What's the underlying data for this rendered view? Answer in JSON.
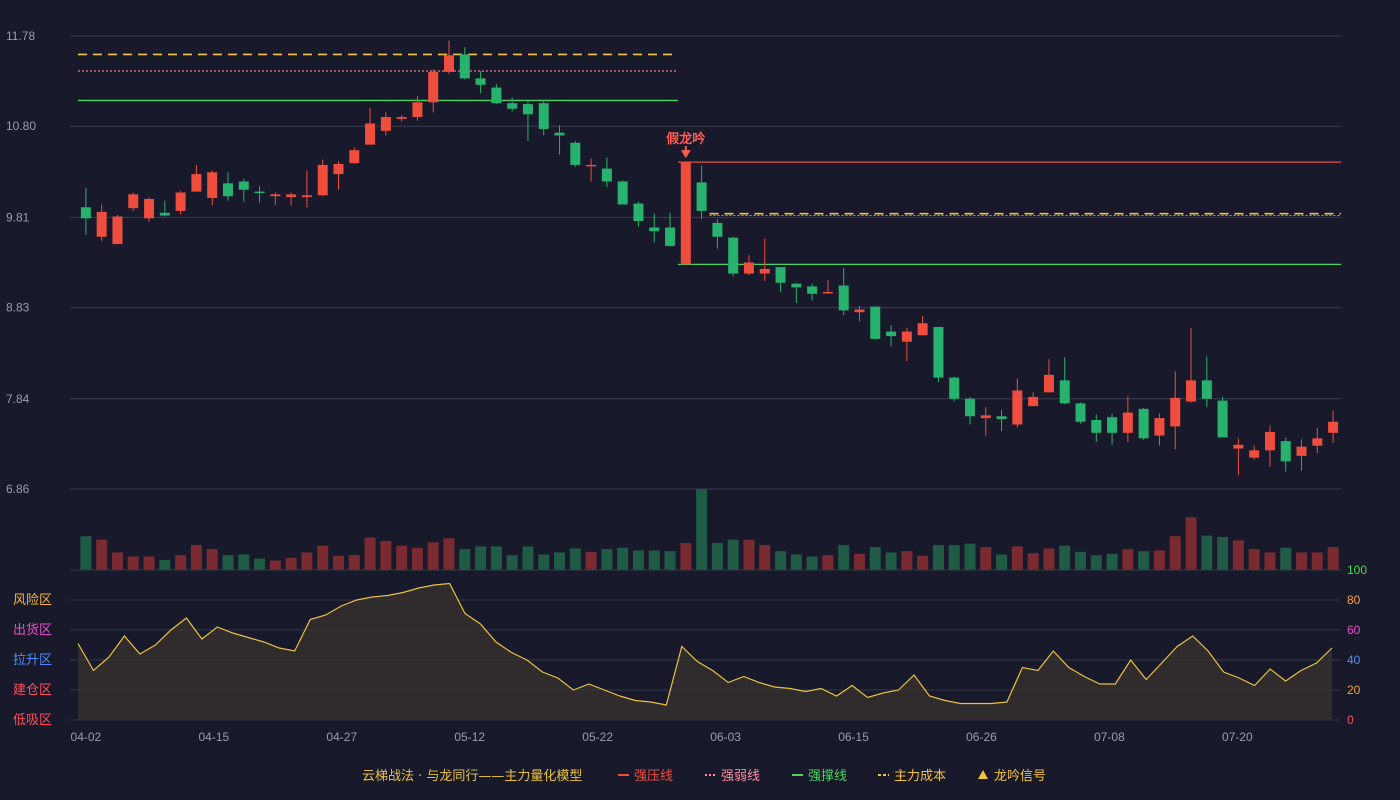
{
  "chart_data": {
    "type": "candlestick",
    "price_axis": {
      "ylim": [
        6.86,
        11.78
      ],
      "ticks": [
        "11.78",
        "10.80",
        "9.81",
        "8.83",
        "7.84",
        "6.86"
      ]
    },
    "x_tick_labels": [
      {
        "index": 0,
        "label": "04-02"
      },
      {
        "index": 8,
        "label": "04-15"
      },
      {
        "index": 16,
        "label": "04-27"
      },
      {
        "index": 24,
        "label": "05-12"
      },
      {
        "index": 32,
        "label": "05-22"
      },
      {
        "index": 40,
        "label": "06-03"
      },
      {
        "index": 48,
        "label": "06-15"
      },
      {
        "index": 56,
        "label": "06-26"
      },
      {
        "index": 64,
        "label": "07-08"
      },
      {
        "index": 72,
        "label": "07-20"
      }
    ],
    "candles": [
      [
        9.92,
        9.8,
        10.13,
        9.62
      ],
      [
        9.6,
        9.87,
        9.95,
        9.55
      ],
      [
        9.52,
        9.82,
        9.84,
        9.52
      ],
      [
        9.91,
        10.06,
        10.08,
        9.88
      ],
      [
        9.8,
        10.01,
        10.03,
        9.76
      ],
      [
        9.86,
        9.83,
        9.99,
        9.82
      ],
      [
        9.88,
        10.08,
        10.1,
        9.84
      ],
      [
        10.09,
        10.28,
        10.38,
        10.09
      ],
      [
        10.02,
        10.3,
        10.32,
        9.94
      ],
      [
        10.18,
        10.04,
        10.3,
        9.99
      ],
      [
        10.2,
        10.11,
        10.23,
        9.98
      ],
      [
        10.09,
        10.08,
        10.15,
        9.97
      ],
      [
        10.04,
        10.06,
        10.08,
        9.95
      ],
      [
        10.03,
        10.06,
        10.08,
        9.94
      ],
      [
        10.03,
        10.05,
        10.32,
        9.92
      ],
      [
        10.05,
        10.38,
        10.44,
        10.04
      ],
      [
        10.28,
        10.39,
        10.42,
        10.11
      ],
      [
        10.4,
        10.54,
        10.57,
        10.39
      ],
      [
        10.6,
        10.83,
        11.0,
        10.62
      ],
      [
        10.75,
        10.9,
        10.95,
        10.7
      ],
      [
        10.88,
        10.9,
        10.92,
        10.85
      ],
      [
        10.9,
        11.06,
        11.13,
        10.86
      ],
      [
        11.06,
        11.39,
        11.42,
        10.95
      ],
      [
        11.39,
        11.57,
        11.73,
        11.37
      ],
      [
        11.58,
        11.32,
        11.66,
        11.31
      ],
      [
        11.32,
        11.25,
        11.4,
        11.16
      ],
      [
        11.22,
        11.05,
        11.26,
        11.04
      ],
      [
        11.05,
        10.99,
        11.11,
        10.96
      ],
      [
        11.04,
        10.93,
        11.07,
        10.64
      ],
      [
        11.05,
        10.77,
        11.08,
        10.7
      ],
      [
        10.73,
        10.7,
        10.81,
        10.49
      ],
      [
        10.62,
        10.38,
        10.64,
        10.36
      ],
      [
        10.38,
        10.38,
        10.45,
        10.2
      ],
      [
        10.34,
        10.2,
        10.46,
        10.14
      ],
      [
        10.2,
        9.95,
        10.21,
        9.96
      ],
      [
        9.96,
        9.77,
        9.98,
        9.71
      ],
      [
        9.7,
        9.66,
        9.85,
        9.54
      ],
      [
        9.7,
        9.5,
        9.86,
        9.49
      ],
      [
        9.3,
        10.41,
        10.41,
        9.3
      ],
      [
        10.19,
        9.88,
        10.37,
        9.79
      ],
      [
        9.75,
        9.6,
        9.79,
        9.47
      ],
      [
        9.59,
        9.2,
        9.6,
        9.17
      ],
      [
        9.2,
        9.32,
        9.4,
        9.18
      ],
      [
        9.2,
        9.25,
        9.58,
        9.12
      ],
      [
        9.27,
        9.1,
        9.27,
        9.0
      ],
      [
        9.09,
        9.05,
        9.1,
        8.88
      ],
      [
        9.06,
        8.98,
        9.09,
        8.91
      ],
      [
        9.0,
        9.0,
        9.13,
        8.98
      ],
      [
        9.07,
        8.8,
        9.26,
        8.75
      ],
      [
        8.78,
        8.81,
        8.85,
        8.68
      ],
      [
        8.84,
        8.49,
        8.85,
        8.48
      ],
      [
        8.57,
        8.52,
        8.64,
        8.41
      ],
      [
        8.46,
        8.57,
        8.61,
        8.25
      ],
      [
        8.53,
        8.66,
        8.74,
        8.53
      ],
      [
        8.62,
        8.07,
        8.62,
        8.02
      ],
      [
        8.07,
        7.84,
        8.08,
        7.81
      ],
      [
        7.84,
        7.65,
        7.86,
        7.56
      ],
      [
        7.63,
        7.66,
        7.75,
        7.44
      ],
      [
        7.65,
        7.62,
        7.72,
        7.49
      ],
      [
        7.56,
        7.93,
        8.06,
        7.53
      ],
      [
        7.76,
        7.86,
        7.91,
        7.76
      ],
      [
        7.91,
        8.1,
        8.27,
        7.91
      ],
      [
        8.04,
        7.79,
        8.29,
        7.78
      ],
      [
        7.79,
        7.59,
        7.8,
        7.57
      ],
      [
        7.61,
        7.47,
        7.67,
        7.37
      ],
      [
        7.64,
        7.47,
        7.68,
        7.34
      ],
      [
        7.47,
        7.69,
        7.87,
        7.37
      ],
      [
        7.73,
        7.41,
        7.74,
        7.39
      ],
      [
        7.44,
        7.63,
        7.68,
        7.33
      ],
      [
        7.54,
        7.85,
        8.14,
        7.29
      ],
      [
        7.81,
        8.04,
        8.61,
        7.8
      ],
      [
        8.04,
        7.84,
        8.3,
        7.75
      ],
      [
        7.82,
        7.42,
        7.86,
        7.42
      ],
      [
        7.3,
        7.34,
        7.41,
        7.01
      ],
      [
        7.2,
        7.28,
        7.33,
        7.18
      ],
      [
        7.28,
        7.48,
        7.55,
        7.1
      ],
      [
        7.38,
        7.16,
        7.42,
        7.05
      ],
      [
        7.22,
        7.32,
        7.4,
        7.06
      ],
      [
        7.33,
        7.41,
        7.52,
        7.25
      ],
      [
        7.47,
        7.59,
        7.71,
        7.36
      ]
    ],
    "volumes": [
      50,
      45,
      26,
      20,
      20,
      15,
      22,
      37,
      31,
      22,
      23,
      17,
      14,
      18,
      26,
      36,
      21,
      22,
      48,
      43,
      36,
      33,
      41,
      47,
      31,
      35,
      35,
      22,
      35,
      23,
      26,
      32,
      27,
      31,
      33,
      29,
      29,
      28,
      40,
      120,
      40,
      45,
      45,
      37,
      28,
      23,
      20,
      22,
      37,
      24,
      34,
      26,
      28,
      21,
      37,
      37,
      39,
      34,
      23,
      35,
      25,
      32,
      36,
      27,
      22,
      24,
      31,
      28,
      29,
      50,
      78,
      51,
      49,
      44,
      31,
      26,
      33,
      26,
      26,
      34
    ],
    "volume_colors_up": [
      true,
      true,
      false,
      false,
      true,
      false,
      false,
      true,
      false,
      true,
      true,
      true,
      true,
      false,
      true,
      false,
      false,
      false,
      true,
      false,
      true,
      false,
      false,
      false,
      true,
      true,
      true,
      true,
      true,
      true,
      true,
      true,
      true,
      true,
      true,
      true,
      true,
      false,
      false,
      true,
      true,
      false,
      false,
      true,
      true,
      true,
      true,
      true,
      true,
      false,
      true,
      false,
      true,
      true,
      false,
      true,
      true,
      true,
      false,
      false,
      false,
      true,
      false,
      false,
      true,
      true,
      true,
      false,
      false,
      false,
      false,
      true,
      true,
      true,
      true,
      true,
      false,
      false,
      true,
      false
    ],
    "oscillator": {
      "ylim": [
        0,
        100
      ],
      "ticks": [
        "100",
        "80",
        "60",
        "40",
        "20",
        "0"
      ],
      "zones": [
        "风险区",
        "出货区",
        "拉升区",
        "建仓区",
        "低吸区"
      ],
      "values": [
        51,
        33,
        42,
        56,
        44,
        50,
        60,
        68,
        54,
        62,
        58,
        55,
        52,
        48,
        46,
        67,
        70,
        76,
        80,
        82,
        83,
        85,
        88,
        90,
        91,
        71,
        64,
        52,
        45,
        40,
        32,
        28,
        20,
        24,
        20,
        16,
        13,
        12,
        10,
        49,
        39,
        33,
        25,
        29,
        25,
        22,
        21,
        19,
        21,
        16,
        23,
        15,
        18,
        20,
        30,
        16,
        13,
        11,
        11,
        11,
        12,
        35,
        33,
        46,
        35,
        29,
        24,
        24,
        40,
        27,
        38,
        49,
        56,
        46,
        32,
        28,
        23,
        34,
        26,
        33,
        38,
        48
      ]
    },
    "lines": {
      "strong_pressure_1": {
        "value": 11.48,
        "from": 0,
        "to": 37
      },
      "strong_pressure_2": {
        "value": 10.41,
        "from": 38,
        "to": 79
      },
      "strong_weak_1": {
        "value": 11.4,
        "from": 0,
        "to": 37
      },
      "support_1": {
        "value": 11.08,
        "from": 0,
        "to": 37
      },
      "support_2": {
        "value": 9.3,
        "from": 38,
        "to": 79
      },
      "main_cost_1": {
        "value": 11.58,
        "from": 0,
        "to": 37
      },
      "main_cost_2": {
        "value": 9.85,
        "from": 40,
        "to": 79
      }
    },
    "signal": {
      "index": 38,
      "label": "假龙吟"
    },
    "colors": {
      "up": "#ef4d3d",
      "down": "#27b26d",
      "vol_up": "#7a2a31",
      "vol_down": "#1f5b45",
      "pressure": "#e34d46",
      "weak": "#f07a8a",
      "support": "#47d461",
      "cost": "#f5c33a",
      "signal": "#ff5b53",
      "osc_line": "#e9c13f",
      "osc_fill": "#3b3530",
      "zone_risk": "#f2b53a",
      "zone_out": "#e84fc7",
      "zone_up": "#4f8cff",
      "zone_build": "#ff4d5d",
      "zone_low": "#ff4d5d"
    }
  },
  "legend": {
    "title": "云梯战法 · 与龙同行——主力量化模型",
    "items": [
      {
        "label": "强压线",
        "color": "#ef4d3d",
        "type": "solid"
      },
      {
        "label": "强弱线",
        "color": "#ff8da0",
        "type": "dotted"
      },
      {
        "label": "强撑线",
        "color": "#47d461",
        "type": "solid"
      },
      {
        "label": "主力成本",
        "color": "#f5c33a",
        "type": "dashed"
      },
      {
        "label": "龙吟信号",
        "color": "#f5c33a",
        "type": "triangle"
      }
    ]
  }
}
